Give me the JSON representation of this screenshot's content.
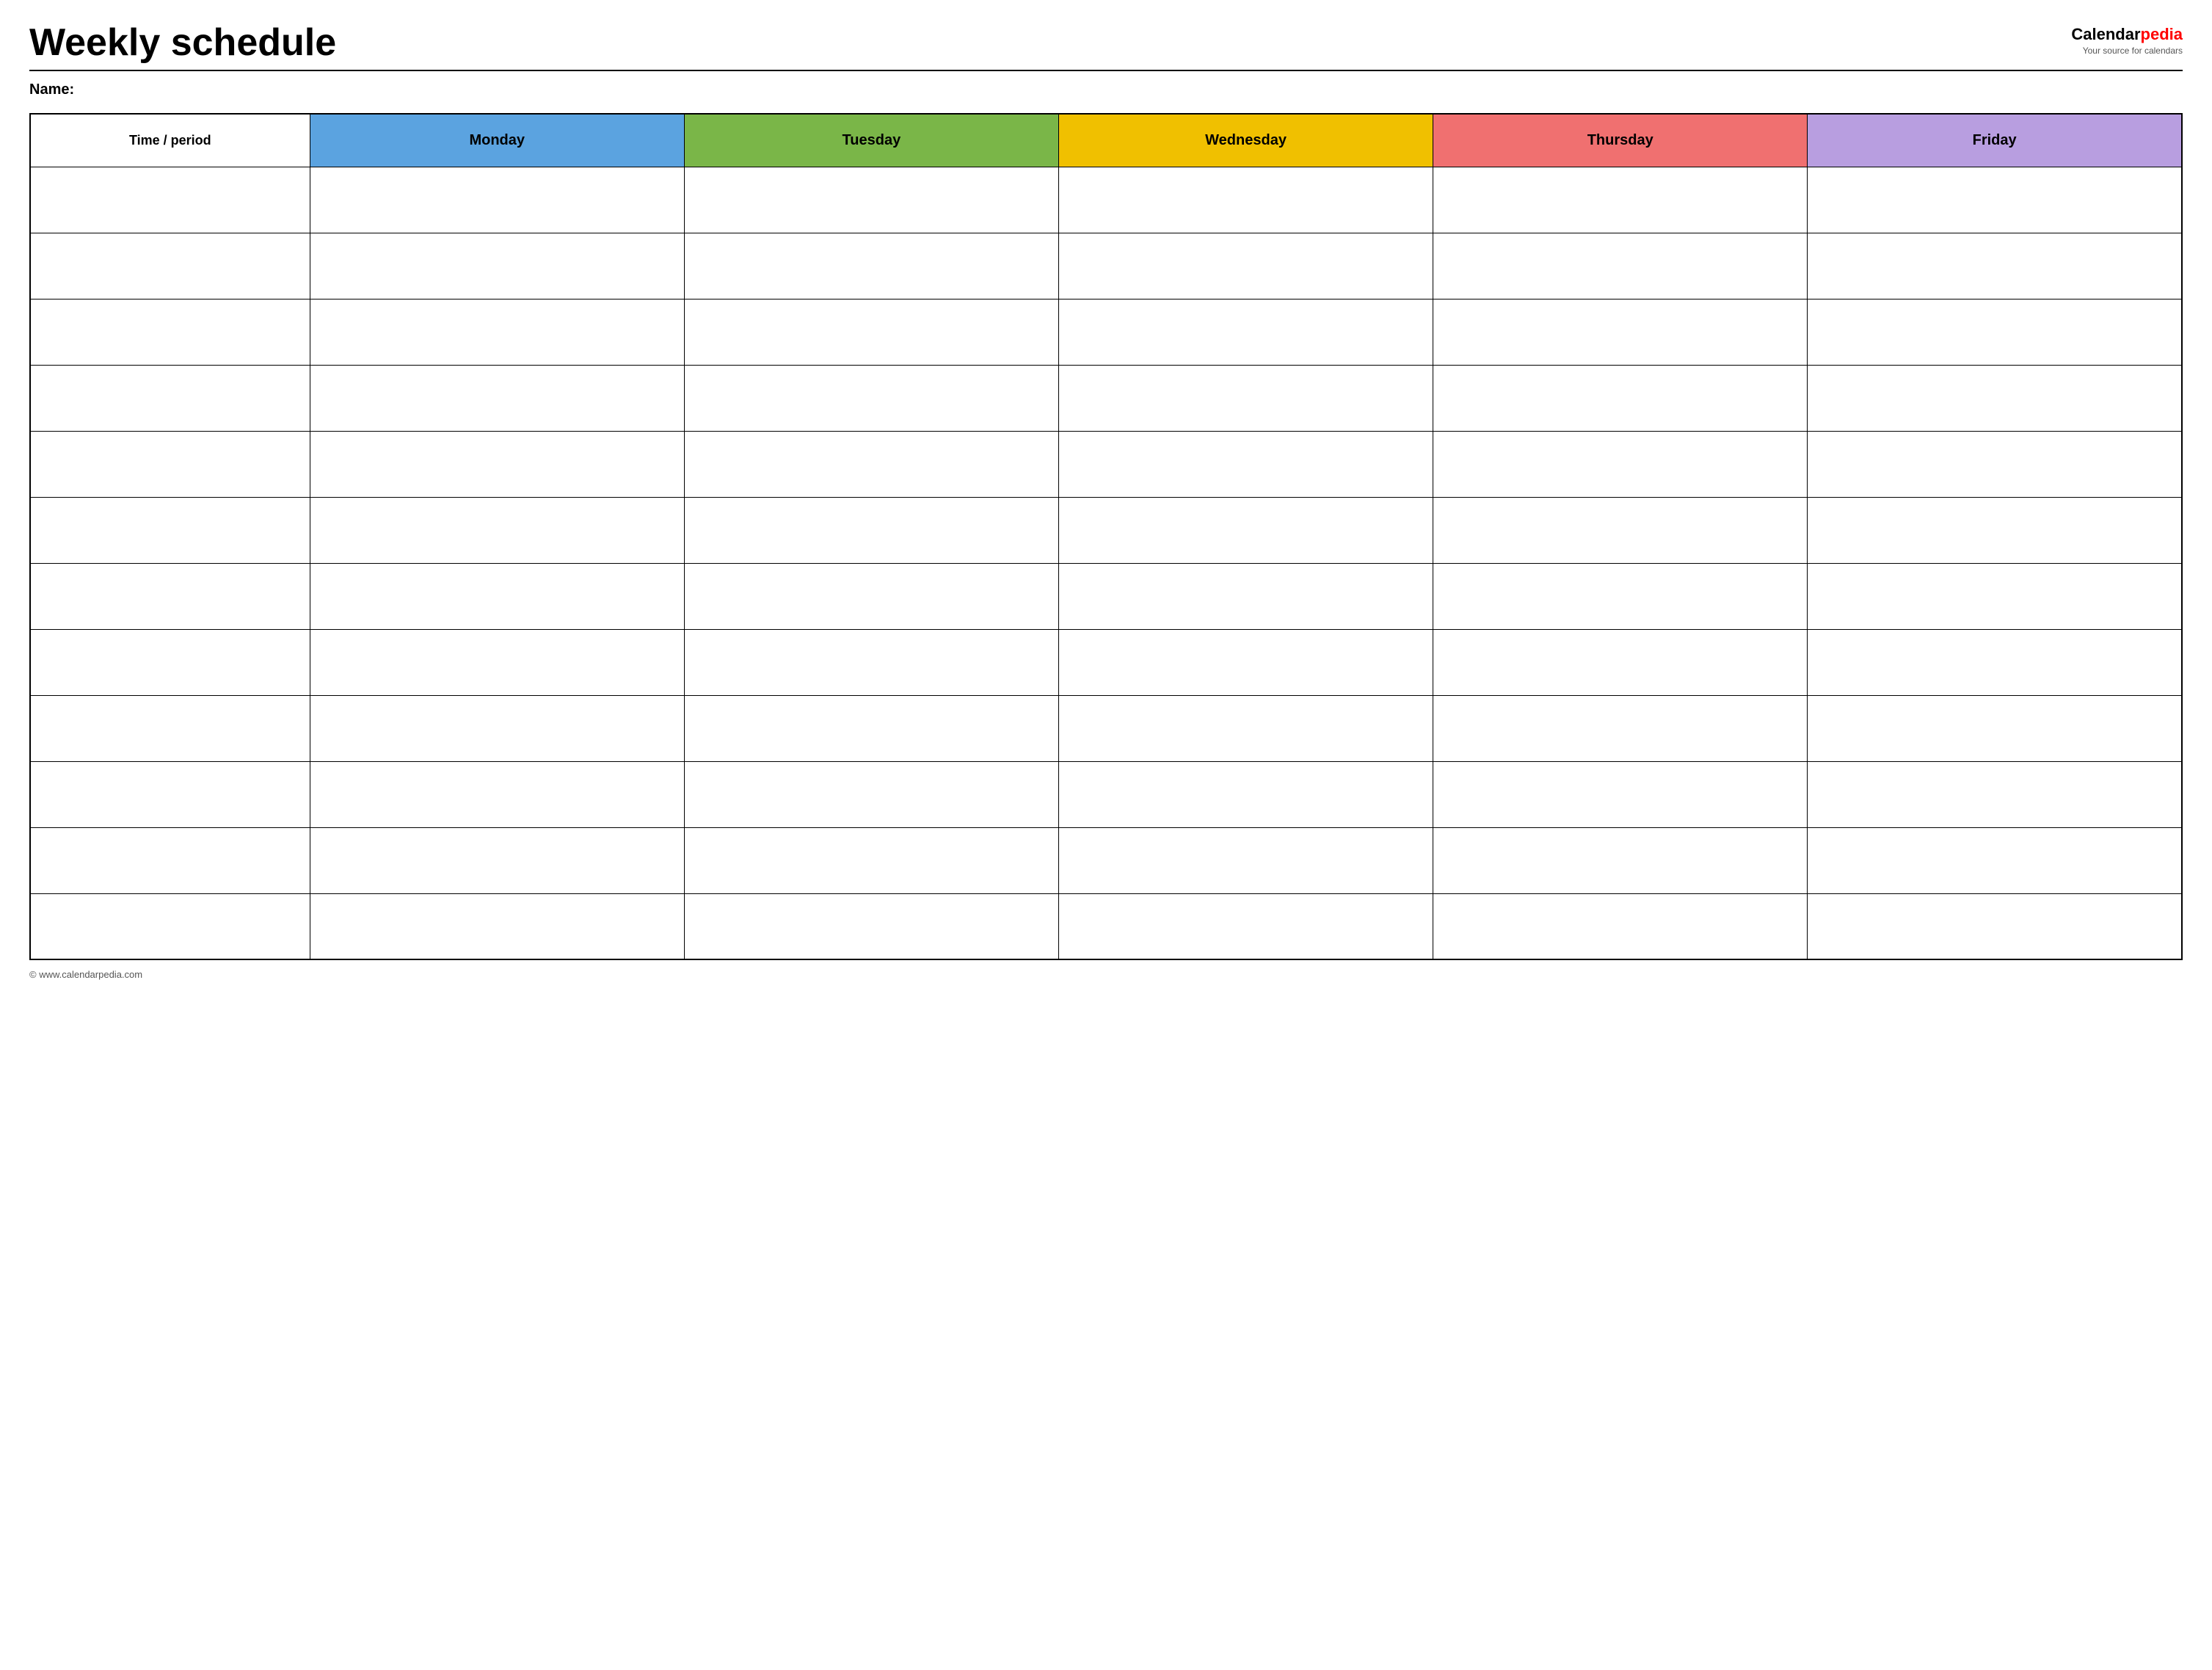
{
  "header": {
    "title": "Weekly schedule",
    "name_label": "Name:",
    "logo": {
      "text_black": "Calendar",
      "text_red": "pedia",
      "subtitle": "Your source for calendars"
    }
  },
  "table": {
    "columns": [
      {
        "id": "time",
        "label": "Time / period",
        "class": "time-header"
      },
      {
        "id": "monday",
        "label": "Monday",
        "class": "monday"
      },
      {
        "id": "tuesday",
        "label": "Tuesday",
        "class": "tuesday"
      },
      {
        "id": "wednesday",
        "label": "Wednesday",
        "class": "wednesday"
      },
      {
        "id": "thursday",
        "label": "Thursday",
        "class": "thursday"
      },
      {
        "id": "friday",
        "label": "Friday",
        "class": "friday"
      }
    ],
    "row_count": 12
  },
  "footer": {
    "text": "© www.calendarpedia.com"
  }
}
